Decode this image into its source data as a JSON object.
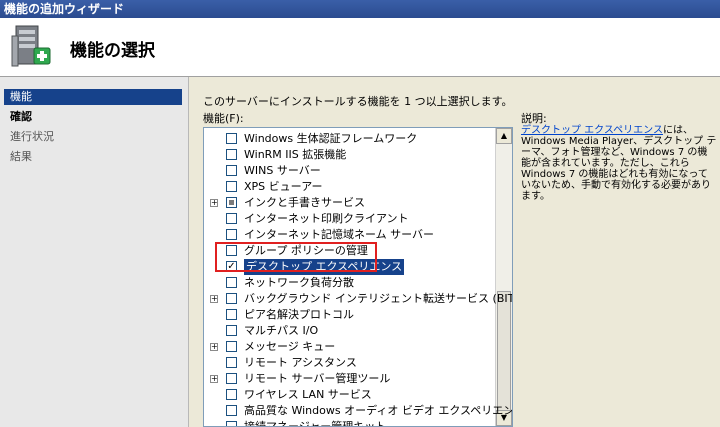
{
  "window": {
    "title": "機能の追加ウィザード"
  },
  "header": {
    "title": "機能の選択",
    "icon": "server-add-icon"
  },
  "nav": {
    "items": [
      {
        "label": "機能",
        "state": "active"
      },
      {
        "label": "確認",
        "state": "bold"
      },
      {
        "label": "進行状況",
        "state": "dim"
      },
      {
        "label": "結果",
        "state": "dim"
      }
    ]
  },
  "main": {
    "instruction": "このサーバーにインストールする機能を 1 つ以上選択します。",
    "features_label": "機能(F):",
    "features": [
      {
        "label": "Windows 生体認証フレームワーク",
        "checked": false,
        "expander": false
      },
      {
        "label": "WinRM IIS 拡張機能",
        "checked": false,
        "expander": false
      },
      {
        "label": "WINS サーバー",
        "checked": false,
        "expander": false
      },
      {
        "label": "XPS ビューアー",
        "checked": false,
        "expander": false
      },
      {
        "label": "インクと手書きサービス",
        "checked": "partial",
        "expander": true
      },
      {
        "label": "インターネット印刷クライアント",
        "checked": false,
        "expander": false
      },
      {
        "label": "インターネット記憶域ネーム サーバー",
        "checked": false,
        "expander": false
      },
      {
        "label": "グループ ポリシーの管理",
        "checked": false,
        "expander": false
      },
      {
        "label": "デスクトップ エクスペリエンス",
        "checked": true,
        "expander": false,
        "selected": true
      },
      {
        "label": "ネットワーク負荷分散",
        "checked": false,
        "expander": false
      },
      {
        "label": "バックグラウンド インテリジェント転送サービス (BITS)",
        "checked": false,
        "expander": true
      },
      {
        "label": "ピア名解決プロトコル",
        "checked": false,
        "expander": false
      },
      {
        "label": "マルチパス I/O",
        "checked": false,
        "expander": false
      },
      {
        "label": "メッセージ キュー",
        "checked": false,
        "expander": true
      },
      {
        "label": "リモート アシスタンス",
        "checked": false,
        "expander": false
      },
      {
        "label": "リモート サーバー管理ツール",
        "checked": false,
        "expander": true
      },
      {
        "label": "ワイヤレス LAN サービス",
        "checked": false,
        "expander": false
      },
      {
        "label": "高品質な Windows オーディオ ビデオ エクスペリエンス",
        "checked": false,
        "expander": false
      },
      {
        "label": "接続マネージャー管理キット",
        "checked": false,
        "expander": false
      }
    ]
  },
  "description": {
    "title": "説明:",
    "link": "デスクトップ エクスペリエンス",
    "text": "には、Windows Media Player、デスクトップ テーマ、フォト管理など、Windows 7 の機能が含まれています。ただし、これら Windows 7 の機能はどれも有効になっていないため、手動で有効化する必要があります。"
  },
  "colors": {
    "selection": "#16428b",
    "highlight_box": "#e02020"
  }
}
